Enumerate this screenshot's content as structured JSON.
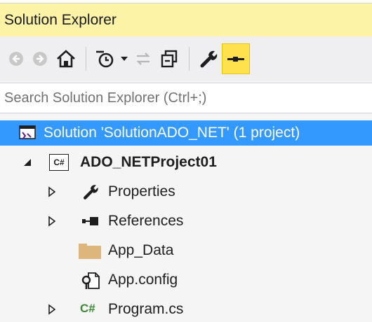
{
  "panel": {
    "title": "Solution Explorer"
  },
  "search": {
    "placeholder": "Search Solution Explorer (Ctrl+;)"
  },
  "toolbar": {
    "buttons": [
      "back-icon",
      "forward-icon",
      "home-icon",
      "pending-changes-icon",
      "dropdown-icon",
      "sync-icon",
      "collapse-all-icon",
      "properties-icon",
      "preview-icon"
    ]
  },
  "tree": {
    "solution": {
      "label": "Solution 'SolutionADO_NET' (1 project)",
      "icon": "solution-icon"
    },
    "project": {
      "label": "ADO_NETProject01",
      "icon": "csharp-project-icon",
      "badge": "C#"
    },
    "items": [
      {
        "label": "Properties",
        "icon": "wrench-icon",
        "expander": "▷"
      },
      {
        "label": "References",
        "icon": "references-icon",
        "expander": "▷"
      },
      {
        "label": "App_Data",
        "icon": "folder-icon"
      },
      {
        "label": "App.config",
        "icon": "config-file-icon"
      },
      {
        "label": "Program.cs",
        "icon": "csharp-file-icon",
        "badge": "C#",
        "expander": "▷"
      }
    ],
    "project_expander": "◢"
  },
  "colors": {
    "selection": "#3399ff",
    "title_bar": "#fdf3a6",
    "accent_yellow": "#ffe14d"
  }
}
